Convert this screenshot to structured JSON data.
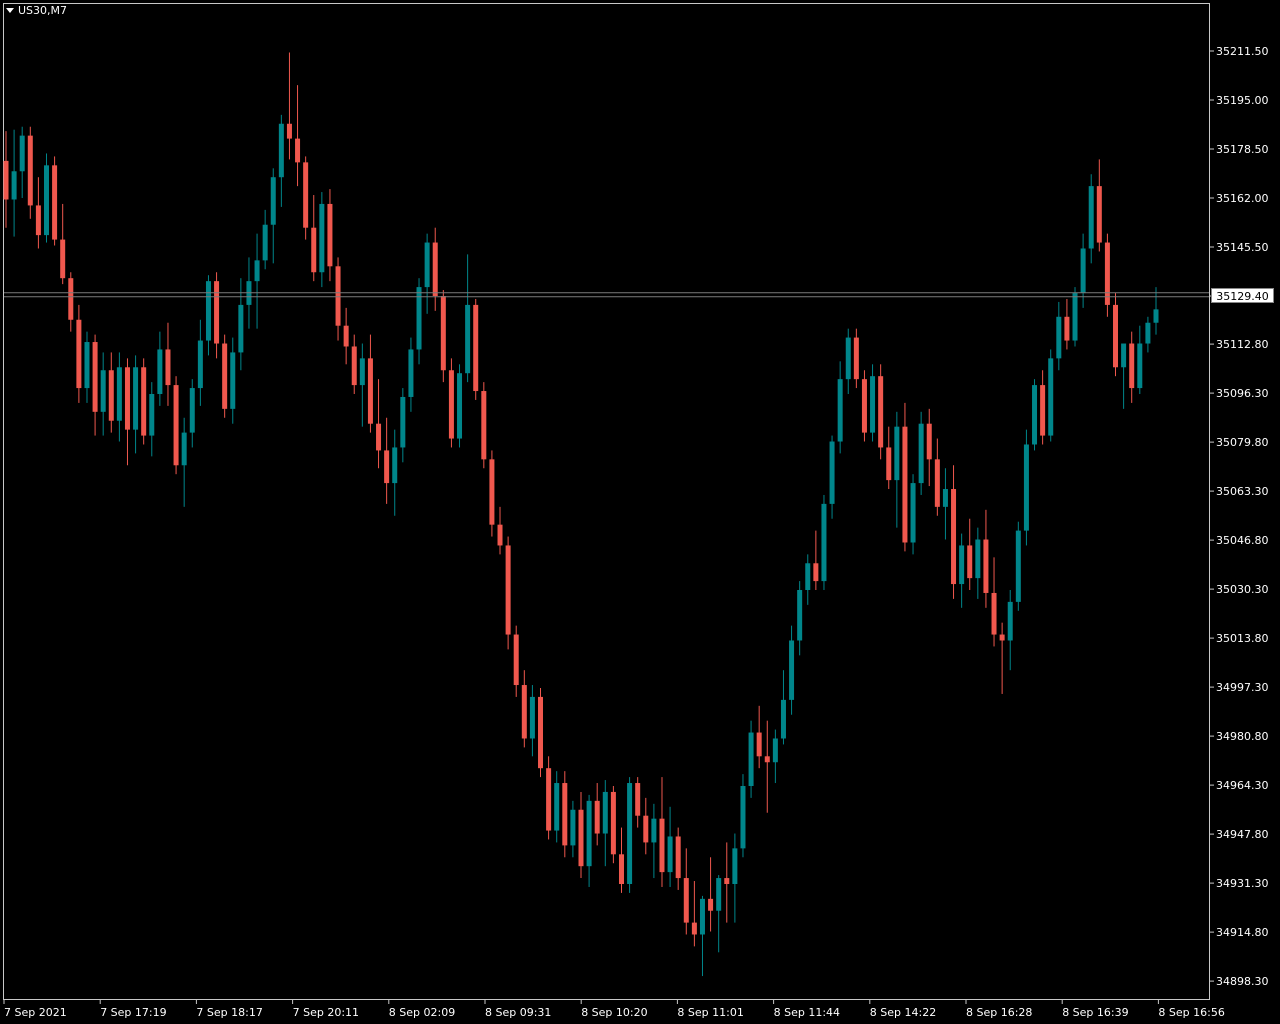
{
  "symbol": "US30,M7",
  "colors": {
    "bull": "#00868b",
    "bear": "#f0584e",
    "background": "#000000",
    "foreground": "#ffffff"
  },
  "current_price": "35129.40",
  "chart_data": {
    "type": "candlestick",
    "title": "US30,M7",
    "y_range": [
      34890.0,
      35220.0
    ],
    "y_ticks": [
      "35211.50",
      "35195.00",
      "35178.50",
      "35162.00",
      "35145.50",
      "35129.00",
      "35112.80",
      "35096.30",
      "35079.80",
      "35063.30",
      "35046.80",
      "35030.30",
      "35013.80",
      "34997.30",
      "34980.80",
      "34964.30",
      "34947.80",
      "34931.30",
      "34914.80",
      "34898.30"
    ],
    "x_ticks": [
      "7 Sep 2021",
      "7 Sep 17:19",
      "7 Sep 18:17",
      "7 Sep 20:11",
      "8 Sep 02:09",
      "8 Sep 09:31",
      "8 Sep 10:20",
      "8 Sep 11:01",
      "8 Sep 11:44",
      "8 Sep 14:22",
      "8 Sep 16:28",
      "8 Sep 16:39",
      "8 Sep 16:56"
    ],
    "candles": [
      {
        "o": 35174.5,
        "h": 35184.5,
        "l": 35152.0,
        "c": 35161.5
      },
      {
        "o": 35161.5,
        "h": 35185.0,
        "l": 35149.0,
        "c": 35171.0
      },
      {
        "o": 35171.0,
        "h": 35186.0,
        "l": 35162.0,
        "c": 35183.0
      },
      {
        "o": 35183.0,
        "h": 35186.0,
        "l": 35155.0,
        "c": 35159.5
      },
      {
        "o": 35159.5,
        "h": 35169.0,
        "l": 35145.0,
        "c": 35149.5
      },
      {
        "o": 35149.5,
        "h": 35177.0,
        "l": 35147.0,
        "c": 35173.0
      },
      {
        "o": 35173.0,
        "h": 35176.0,
        "l": 35146.0,
        "c": 35148.0
      },
      {
        "o": 35148.0,
        "h": 35160.0,
        "l": 35133.0,
        "c": 35135.0
      },
      {
        "o": 35135.0,
        "h": 35137.0,
        "l": 35117.0,
        "c": 35121.0
      },
      {
        "o": 35121.0,
        "h": 35126.0,
        "l": 35093.0,
        "c": 35098.0
      },
      {
        "o": 35098.0,
        "h": 35117.0,
        "l": 35093.0,
        "c": 35113.5
      },
      {
        "o": 35113.5,
        "h": 35116.0,
        "l": 35082.0,
        "c": 35090.0
      },
      {
        "o": 35090.0,
        "h": 35110.0,
        "l": 35082.0,
        "c": 35104.0
      },
      {
        "o": 35104.0,
        "h": 35110.0,
        "l": 35083.0,
        "c": 35087.0
      },
      {
        "o": 35087.0,
        "h": 35110.0,
        "l": 35080.0,
        "c": 35105.0
      },
      {
        "o": 35105.0,
        "h": 35108.0,
        "l": 35072.0,
        "c": 35084.0
      },
      {
        "o": 35084.0,
        "h": 35109.0,
        "l": 35076.0,
        "c": 35105.0
      },
      {
        "o": 35105.0,
        "h": 35108.0,
        "l": 35079.0,
        "c": 35082.0
      },
      {
        "o": 35082.0,
        "h": 35100.0,
        "l": 35075.0,
        "c": 35096.0
      },
      {
        "o": 35096.0,
        "h": 35117.0,
        "l": 35092.0,
        "c": 35111.0
      },
      {
        "o": 35111.0,
        "h": 35120.0,
        "l": 35092.0,
        "c": 35099.0
      },
      {
        "o": 35099.0,
        "h": 35102.0,
        "l": 35069.0,
        "c": 35072.0
      },
      {
        "o": 35072.0,
        "h": 35088.0,
        "l": 35058.0,
        "c": 35083.0
      },
      {
        "o": 35083.0,
        "h": 35101.0,
        "l": 35078.0,
        "c": 35098.0
      },
      {
        "o": 35098.0,
        "h": 35121.0,
        "l": 35092.0,
        "c": 35114.0
      },
      {
        "o": 35114.0,
        "h": 35136.0,
        "l": 35109.0,
        "c": 35134.0
      },
      {
        "o": 35134.0,
        "h": 35137.0,
        "l": 35108.0,
        "c": 35113.0
      },
      {
        "o": 35113.0,
        "h": 35116.0,
        "l": 35088.0,
        "c": 35091.0
      },
      {
        "o": 35091.0,
        "h": 35115.0,
        "l": 35086.0,
        "c": 35110.0
      },
      {
        "o": 35110.0,
        "h": 35135.0,
        "l": 35104.0,
        "c": 35126.0
      },
      {
        "o": 35126.0,
        "h": 35142.0,
        "l": 35118.0,
        "c": 35134.0
      },
      {
        "o": 35134.0,
        "h": 35150.0,
        "l": 35118.0,
        "c": 35141.0
      },
      {
        "o": 35141.0,
        "h": 35158.0,
        "l": 35138.0,
        "c": 35153.0
      },
      {
        "o": 35153.0,
        "h": 35172.0,
        "l": 35140.0,
        "c": 35169.0
      },
      {
        "o": 35169.0,
        "h": 35190.0,
        "l": 35159.0,
        "c": 35187.0
      },
      {
        "o": 35187.0,
        "h": 35211.0,
        "l": 35175.0,
        "c": 35182.0
      },
      {
        "o": 35182.0,
        "h": 35200.0,
        "l": 35166.0,
        "c": 35174.0
      },
      {
        "o": 35174.0,
        "h": 35176.0,
        "l": 35148.0,
        "c": 35152.0
      },
      {
        "o": 35152.0,
        "h": 35163.0,
        "l": 35134.0,
        "c": 35137.0
      },
      {
        "o": 35137.0,
        "h": 35164.0,
        "l": 35132.0,
        "c": 35160.0
      },
      {
        "o": 35160.0,
        "h": 35165.0,
        "l": 35134.0,
        "c": 35139.0
      },
      {
        "o": 35139.0,
        "h": 35142.0,
        "l": 35114.0,
        "c": 35119.0
      },
      {
        "o": 35119.0,
        "h": 35125.0,
        "l": 35106.0,
        "c": 35112.0
      },
      {
        "o": 35112.0,
        "h": 35116.0,
        "l": 35096.0,
        "c": 35099.0
      },
      {
        "o": 35099.0,
        "h": 35113.0,
        "l": 35085.0,
        "c": 35108.0
      },
      {
        "o": 35108.0,
        "h": 35116.0,
        "l": 35083.0,
        "c": 35086.0
      },
      {
        "o": 35086.0,
        "h": 35101.0,
        "l": 35071.0,
        "c": 35077.0
      },
      {
        "o": 35077.0,
        "h": 35088.0,
        "l": 35059.0,
        "c": 35066.0
      },
      {
        "o": 35066.0,
        "h": 35084.0,
        "l": 35055.0,
        "c": 35078.0
      },
      {
        "o": 35078.0,
        "h": 35098.0,
        "l": 35073.0,
        "c": 35095.0
      },
      {
        "o": 35095.0,
        "h": 35115.0,
        "l": 35090.0,
        "c": 35111.0
      },
      {
        "o": 35111.0,
        "h": 35135.0,
        "l": 35106.0,
        "c": 35132.0
      },
      {
        "o": 35132.0,
        "h": 35150.0,
        "l": 35123.0,
        "c": 35147.0
      },
      {
        "o": 35147.0,
        "h": 35152.0,
        "l": 35124.0,
        "c": 35129.0
      },
      {
        "o": 35129.0,
        "h": 35131.0,
        "l": 35100.0,
        "c": 35104.0
      },
      {
        "o": 35104.0,
        "h": 35108.0,
        "l": 35078.0,
        "c": 35081.0
      },
      {
        "o": 35081.0,
        "h": 35106.0,
        "l": 35078.0,
        "c": 35103.0
      },
      {
        "o": 35103.0,
        "h": 35143.0,
        "l": 35100.0,
        "c": 35126.0
      },
      {
        "o": 35126.0,
        "h": 35128.0,
        "l": 35094.0,
        "c": 35097.0
      },
      {
        "o": 35097.0,
        "h": 35100.0,
        "l": 35071.0,
        "c": 35074.0
      },
      {
        "o": 35074.0,
        "h": 35077.0,
        "l": 35048.0,
        "c": 35052.0
      },
      {
        "o": 35052.0,
        "h": 35058.0,
        "l": 35042.0,
        "c": 35045.0
      },
      {
        "o": 35045.0,
        "h": 35048.0,
        "l": 35010.0,
        "c": 35015.0
      },
      {
        "o": 35015.0,
        "h": 35018.0,
        "l": 34994.0,
        "c": 34998.0
      },
      {
        "o": 34998.0,
        "h": 35003.0,
        "l": 34977.0,
        "c": 34980.0
      },
      {
        "o": 34980.0,
        "h": 34998.0,
        "l": 34974.0,
        "c": 34994.0
      },
      {
        "o": 34994.0,
        "h": 34997.0,
        "l": 34967.0,
        "c": 34970.0
      },
      {
        "o": 34970.0,
        "h": 34974.0,
        "l": 34946.0,
        "c": 34949.0
      },
      {
        "o": 34949.0,
        "h": 34969.0,
        "l": 34945.0,
        "c": 34965.0
      },
      {
        "o": 34965.0,
        "h": 34969.0,
        "l": 34940.0,
        "c": 34944.0
      },
      {
        "o": 34944.0,
        "h": 34959.0,
        "l": 34940.0,
        "c": 34956.0
      },
      {
        "o": 34956.0,
        "h": 34962.0,
        "l": 34933.0,
        "c": 34937.0
      },
      {
        "o": 34937.0,
        "h": 34961.0,
        "l": 34930.0,
        "c": 34959.0
      },
      {
        "o": 34959.0,
        "h": 34965.0,
        "l": 34944.0,
        "c": 34948.0
      },
      {
        "o": 34948.0,
        "h": 34966.0,
        "l": 34937.0,
        "c": 34962.0
      },
      {
        "o": 34962.0,
        "h": 34964.0,
        "l": 34938.0,
        "c": 34941.0
      },
      {
        "o": 34941.0,
        "h": 34950.0,
        "l": 34928.0,
        "c": 34931.0
      },
      {
        "o": 34931.0,
        "h": 34967.0,
        "l": 34928.0,
        "c": 34965.0
      },
      {
        "o": 34965.0,
        "h": 34967.0,
        "l": 34950.0,
        "c": 34954.0
      },
      {
        "o": 34954.0,
        "h": 34960.0,
        "l": 34941.0,
        "c": 34945.0
      },
      {
        "o": 34945.0,
        "h": 34958.0,
        "l": 34933.0,
        "c": 34953.0
      },
      {
        "o": 34953.0,
        "h": 34967.0,
        "l": 34930.0,
        "c": 34935.0
      },
      {
        "o": 34935.0,
        "h": 34957.0,
        "l": 34930.0,
        "c": 34947.0
      },
      {
        "o": 34947.0,
        "h": 34950.0,
        "l": 34929.0,
        "c": 34933.0
      },
      {
        "o": 34933.0,
        "h": 34943.0,
        "l": 34914.0,
        "c": 34918.0
      },
      {
        "o": 34918.0,
        "h": 34932.0,
        "l": 34910.0,
        "c": 34914.0
      },
      {
        "o": 34914.0,
        "h": 34927.0,
        "l": 34900.0,
        "c": 34926.0
      },
      {
        "o": 34926.0,
        "h": 34940.0,
        "l": 34915.0,
        "c": 34922.0
      },
      {
        "o": 34922.0,
        "h": 34934.0,
        "l": 34908.0,
        "c": 34933.0
      },
      {
        "o": 34933.0,
        "h": 34945.0,
        "l": 34918.0,
        "c": 34931.0
      },
      {
        "o": 34931.0,
        "h": 34948.0,
        "l": 34918.0,
        "c": 34943.0
      },
      {
        "o": 34943.0,
        "h": 34968.0,
        "l": 34940.0,
        "c": 34964.0
      },
      {
        "o": 34964.0,
        "h": 34986.0,
        "l": 34960.0,
        "c": 34982.0
      },
      {
        "o": 34982.0,
        "h": 34991.0,
        "l": 34970.0,
        "c": 34974.0
      },
      {
        "o": 34974.0,
        "h": 34986.0,
        "l": 34955.0,
        "c": 34972.0
      },
      {
        "o": 34972.0,
        "h": 34983.0,
        "l": 34965.0,
        "c": 34980.0
      },
      {
        "o": 34980.0,
        "h": 35003.0,
        "l": 34978.0,
        "c": 34993.0
      },
      {
        "o": 34993.0,
        "h": 35018.0,
        "l": 34988.0,
        "c": 35013.0
      },
      {
        "o": 35013.0,
        "h": 35033.0,
        "l": 35008.0,
        "c": 35030.0
      },
      {
        "o": 35030.0,
        "h": 35042.0,
        "l": 35025.0,
        "c": 35039.0
      },
      {
        "o": 35039.0,
        "h": 35050.0,
        "l": 35030.0,
        "c": 35033.0
      },
      {
        "o": 35033.0,
        "h": 35062.0,
        "l": 35030.0,
        "c": 35059.0
      },
      {
        "o": 35059.0,
        "h": 35082.0,
        "l": 35054.0,
        "c": 35080.0
      },
      {
        "o": 35080.0,
        "h": 35107.0,
        "l": 35076.0,
        "c": 35101.0
      },
      {
        "o": 35101.0,
        "h": 35118.0,
        "l": 35096.0,
        "c": 35115.0
      },
      {
        "o": 35115.0,
        "h": 35118.0,
        "l": 35098.0,
        "c": 35101.0
      },
      {
        "o": 35101.0,
        "h": 35104.0,
        "l": 35080.0,
        "c": 35083.0
      },
      {
        "o": 35083.0,
        "h": 35106.0,
        "l": 35080.0,
        "c": 35102.0
      },
      {
        "o": 35102.0,
        "h": 35106.0,
        "l": 35074.0,
        "c": 35078.0
      },
      {
        "o": 35078.0,
        "h": 35085.0,
        "l": 35064.0,
        "c": 35067.0
      },
      {
        "o": 35067.0,
        "h": 35090.0,
        "l": 35051.0,
        "c": 35085.0
      },
      {
        "o": 35085.0,
        "h": 35093.0,
        "l": 35043.0,
        "c": 35046.0
      },
      {
        "o": 35046.0,
        "h": 35069.0,
        "l": 35042.0,
        "c": 35066.0
      },
      {
        "o": 35066.0,
        "h": 35090.0,
        "l": 35062.0,
        "c": 35086.0
      },
      {
        "o": 35086.0,
        "h": 35091.0,
        "l": 35065.0,
        "c": 35074.0
      },
      {
        "o": 35074.0,
        "h": 35081.0,
        "l": 35055.0,
        "c": 35058.0
      },
      {
        "o": 35058.0,
        "h": 35071.0,
        "l": 35047.0,
        "c": 35064.0
      },
      {
        "o": 35064.0,
        "h": 35072.0,
        "l": 35027.0,
        "c": 35032.0
      },
      {
        "o": 35032.0,
        "h": 35049.0,
        "l": 35024.0,
        "c": 35045.0
      },
      {
        "o": 35045.0,
        "h": 35054.0,
        "l": 35030.0,
        "c": 35034.0
      },
      {
        "o": 35034.0,
        "h": 35051.0,
        "l": 35027.0,
        "c": 35047.0
      },
      {
        "o": 35047.0,
        "h": 35057.0,
        "l": 35024.0,
        "c": 35029.0
      },
      {
        "o": 35029.0,
        "h": 35041.0,
        "l": 35011.0,
        "c": 35015.0
      },
      {
        "o": 35015.0,
        "h": 35019.0,
        "l": 34995.0,
        "c": 35013.0
      },
      {
        "o": 35013.0,
        "h": 35030.0,
        "l": 35003.0,
        "c": 35026.0
      },
      {
        "o": 35026.0,
        "h": 35053.0,
        "l": 35023.0,
        "c": 35050.0
      },
      {
        "o": 35050.0,
        "h": 35084.0,
        "l": 35045.0,
        "c": 35079.0
      },
      {
        "o": 35079.0,
        "h": 35101.0,
        "l": 35077.0,
        "c": 35099.0
      },
      {
        "o": 35099.0,
        "h": 35104.0,
        "l": 35079.0,
        "c": 35082.0
      },
      {
        "o": 35082.0,
        "h": 35111.0,
        "l": 35080.0,
        "c": 35108.0
      },
      {
        "o": 35108.0,
        "h": 35127.0,
        "l": 35104.0,
        "c": 35122.0
      },
      {
        "o": 35122.0,
        "h": 35128.0,
        "l": 35111.0,
        "c": 35114.0
      },
      {
        "o": 35114.0,
        "h": 35132.0,
        "l": 35112.0,
        "c": 35130.0
      },
      {
        "o": 35130.0,
        "h": 35150.0,
        "l": 35125.0,
        "c": 35145.0
      },
      {
        "o": 35145.0,
        "h": 35170.0,
        "l": 35140.0,
        "c": 35166.0
      },
      {
        "o": 35166.0,
        "h": 35175.0,
        "l": 35144.0,
        "c": 35147.0
      },
      {
        "o": 35147.0,
        "h": 35150.0,
        "l": 35122.0,
        "c": 35126.0
      },
      {
        "o": 35126.0,
        "h": 35130.0,
        "l": 35102.0,
        "c": 35105.0
      },
      {
        "o": 35105.0,
        "h": 35112.0,
        "l": 35091.0,
        "c": 35113.0
      },
      {
        "o": 35113.0,
        "h": 35117.0,
        "l": 35093.0,
        "c": 35098.0
      },
      {
        "o": 35098.0,
        "h": 35119.0,
        "l": 35096.0,
        "c": 35113.0
      },
      {
        "o": 35113.0,
        "h": 35122.0,
        "l": 35110.0,
        "c": 35120.0
      },
      {
        "o": 35120.0,
        "h": 35132.0,
        "l": 35116.0,
        "c": 35124.5
      }
    ]
  }
}
